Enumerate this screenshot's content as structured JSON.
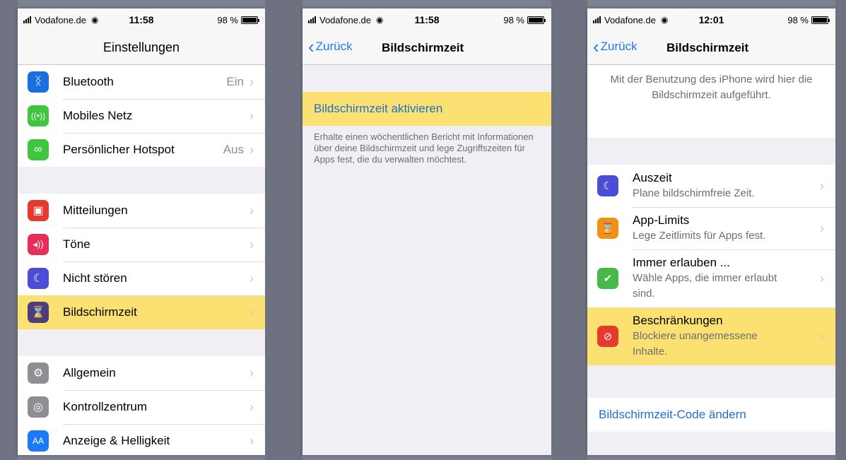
{
  "colors": {
    "ios_blue": "#1b7bf6",
    "highlight": "#fbe171",
    "bluetooth": "#1a6fe0",
    "mobile": "#3ec63e",
    "hotspot": "#3ec63e",
    "notifications": "#e8392f",
    "sounds": "#e62e58",
    "dnd": "#4b4ed4",
    "screentime": "#4e3d7d",
    "general": "#8e8e93",
    "control": "#8e8e93",
    "display": "#1b7bf6",
    "downtime": "#4b4ed4",
    "applimits": "#f29118",
    "always": "#45b94a",
    "restrictions": "#e8392f"
  },
  "phone1": {
    "status": {
      "carrier": "Vodafone.de",
      "time": "11:58",
      "battery": "98 %",
      "battery_level": 0.98
    },
    "title": "Einstellungen",
    "group1": [
      {
        "label": "Bluetooth",
        "value": "Ein",
        "icon": "bluetooth-icon"
      },
      {
        "label": "Mobiles Netz",
        "value": "",
        "icon": "antenna-icon"
      },
      {
        "label": "Persönlicher Hotspot",
        "value": "Aus",
        "icon": "hotspot-icon"
      }
    ],
    "group2": [
      {
        "label": "Mitteilungen",
        "icon": "notifications-icon"
      },
      {
        "label": "Töne",
        "icon": "speaker-icon"
      },
      {
        "label": "Nicht stören",
        "icon": "moon-icon"
      },
      {
        "label": "Bildschirmzeit",
        "icon": "hourglass-icon"
      }
    ],
    "group3": [
      {
        "label": "Allgemein",
        "icon": "gear-icon"
      },
      {
        "label": "Kontrollzentrum",
        "icon": "toggles-icon"
      },
      {
        "label": "Anzeige & Helligkeit",
        "icon": "display-icon",
        "glyph": "AA"
      }
    ]
  },
  "phone2": {
    "status": {
      "carrier": "Vodafone.de",
      "time": "11:58",
      "battery": "98 %",
      "battery_level": 0.98
    },
    "back": "Zurück",
    "title": "Bildschirmzeit",
    "activate": "Bildschirmzeit aktivieren",
    "footnote": "Erhalte einen wöchentlichen Bericht mit Informationen über deine Bildschirmzeit und lege Zugriffszeiten für Apps fest, die du verwalten möchtest."
  },
  "phone3": {
    "status": {
      "carrier": "Vodafone.de",
      "time": "12:01",
      "battery": "98 %",
      "battery_level": 0.98
    },
    "back": "Zurück",
    "title": "Bildschirmzeit",
    "info": "Mit der Benutzung des iPhone wird hier die Bildschirmzeit aufgeführt.",
    "items": [
      {
        "title": "Auszeit",
        "subtitle": "Plane bildschirmfreie Zeit.",
        "icon": "downtime-icon"
      },
      {
        "title": "App-Limits",
        "subtitle": "Lege Zeitlimits für Apps fest.",
        "icon": "hourglass-icon"
      },
      {
        "title": "Immer erlauben ...",
        "subtitle": "Wähle Apps, die immer erlaubt sind.",
        "icon": "checkmark-icon"
      },
      {
        "title": "Beschränkungen",
        "subtitle": "Blockiere unangemessene Inhalte.",
        "icon": "restriction-icon"
      }
    ],
    "code_link": "Bildschirmzeit-Code ändern"
  }
}
